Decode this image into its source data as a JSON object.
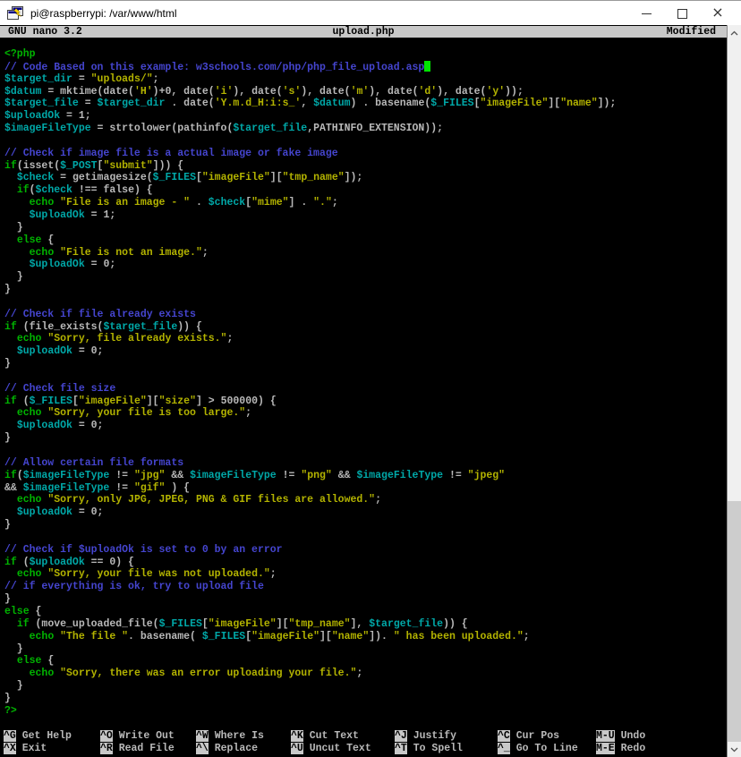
{
  "window": {
    "title": "pi@raspberrypi: /var/www/html",
    "controls": {
      "minimize": "minimize",
      "maximize": "maximize",
      "close": "close"
    }
  },
  "nano": {
    "app": "GNU nano 3.2",
    "filename": "upload.php",
    "status": "Modified"
  },
  "palette": {
    "background": "#000000",
    "default_text": "#b9b9b9",
    "keyword_green": "#00b300",
    "comment_blue": "#4545cf",
    "variable_teal": "#00a8a8",
    "string_yellow": "#b3b300",
    "cursor_green": "#00e400",
    "reverse_video": "#c8c8c8"
  },
  "editor": {
    "lines": [
      {
        "segs": [
          [
            "g",
            "<?php"
          ]
        ]
      },
      {
        "segs": [
          [
            "b",
            "// Code Based on this example: w3schools.com/php/php_file_upload.asp"
          ]
        ],
        "cursor": true
      },
      {
        "segs": [
          [
            "c",
            "$target_dir"
          ],
          [
            "w",
            " = "
          ],
          [
            "y",
            "\"uploads/\""
          ],
          [
            "w",
            ";"
          ]
        ]
      },
      {
        "segs": [
          [
            "c",
            "$datum"
          ],
          [
            "w",
            " = mktime(date("
          ],
          [
            "y",
            "'H'"
          ],
          [
            "w",
            ")+0, date("
          ],
          [
            "y",
            "'i'"
          ],
          [
            "w",
            "), date("
          ],
          [
            "y",
            "'s'"
          ],
          [
            "w",
            "), date("
          ],
          [
            "y",
            "'m'"
          ],
          [
            "w",
            "), date("
          ],
          [
            "y",
            "'d'"
          ],
          [
            "w",
            "), date("
          ],
          [
            "y",
            "'y'"
          ],
          [
            "w",
            "));"
          ]
        ]
      },
      {
        "segs": [
          [
            "c",
            "$target_file"
          ],
          [
            "w",
            " = "
          ],
          [
            "c",
            "$target_dir"
          ],
          [
            "w",
            " . date("
          ],
          [
            "y",
            "'Y.m.d_H:i:s_'"
          ],
          [
            "w",
            ", "
          ],
          [
            "c",
            "$datum"
          ],
          [
            "w",
            ") . basename("
          ],
          [
            "c",
            "$_FILES"
          ],
          [
            "w",
            "["
          ],
          [
            "y",
            "\"imageFile\""
          ],
          [
            "w",
            "]["
          ],
          [
            "y",
            "\"name\""
          ],
          [
            "w",
            "]);"
          ]
        ]
      },
      {
        "segs": [
          [
            "c",
            "$uploadOk"
          ],
          [
            "w",
            " = 1;"
          ]
        ]
      },
      {
        "segs": [
          [
            "c",
            "$imageFileType"
          ],
          [
            "w",
            " = strtolower(pathinfo("
          ],
          [
            "c",
            "$target_file"
          ],
          [
            "w",
            ",PATHINFO_EXTENSION));"
          ]
        ]
      },
      {
        "segs": []
      },
      {
        "segs": [
          [
            "b",
            "// Check if image file is a actual image or fake image"
          ]
        ]
      },
      {
        "segs": [
          [
            "g",
            "if"
          ],
          [
            "w",
            "(isset("
          ],
          [
            "c",
            "$_POST"
          ],
          [
            "w",
            "["
          ],
          [
            "y",
            "\"submit\""
          ],
          [
            "w",
            "])) {"
          ]
        ]
      },
      {
        "segs": [
          [
            "w",
            "  "
          ],
          [
            "c",
            "$check"
          ],
          [
            "w",
            " = getimagesize("
          ],
          [
            "c",
            "$_FILES"
          ],
          [
            "w",
            "["
          ],
          [
            "y",
            "\"imageFile\""
          ],
          [
            "w",
            "]["
          ],
          [
            "y",
            "\"tmp_name\""
          ],
          [
            "w",
            "]);"
          ]
        ]
      },
      {
        "segs": [
          [
            "w",
            "  "
          ],
          [
            "g",
            "if"
          ],
          [
            "w",
            "("
          ],
          [
            "c",
            "$check"
          ],
          [
            "w",
            " !== false) {"
          ]
        ]
      },
      {
        "segs": [
          [
            "w",
            "    "
          ],
          [
            "g",
            "echo"
          ],
          [
            "w",
            " "
          ],
          [
            "y",
            "\"File is an image - \""
          ],
          [
            "w",
            " . "
          ],
          [
            "c",
            "$check"
          ],
          [
            "w",
            "["
          ],
          [
            "y",
            "\"mime\""
          ],
          [
            "w",
            "] . "
          ],
          [
            "y",
            "\".\""
          ],
          [
            "w",
            ";"
          ]
        ]
      },
      {
        "segs": [
          [
            "w",
            "    "
          ],
          [
            "c",
            "$uploadOk"
          ],
          [
            "w",
            " = 1;"
          ]
        ]
      },
      {
        "segs": [
          [
            "w",
            "  }"
          ]
        ]
      },
      {
        "segs": [
          [
            "w",
            "  "
          ],
          [
            "g",
            "else"
          ],
          [
            "w",
            " {"
          ]
        ]
      },
      {
        "segs": [
          [
            "w",
            "    "
          ],
          [
            "g",
            "echo"
          ],
          [
            "w",
            " "
          ],
          [
            "y",
            "\"File is not an image.\""
          ],
          [
            "w",
            ";"
          ]
        ]
      },
      {
        "segs": [
          [
            "w",
            "    "
          ],
          [
            "c",
            "$uploadOk"
          ],
          [
            "w",
            " = 0;"
          ]
        ]
      },
      {
        "segs": [
          [
            "w",
            "  }"
          ]
        ]
      },
      {
        "segs": [
          [
            "w",
            "}"
          ]
        ]
      },
      {
        "segs": []
      },
      {
        "segs": [
          [
            "b",
            "// Check if file already exists"
          ]
        ]
      },
      {
        "segs": [
          [
            "g",
            "if"
          ],
          [
            "w",
            " (file_exists("
          ],
          [
            "c",
            "$target_file"
          ],
          [
            "w",
            ")) {"
          ]
        ]
      },
      {
        "segs": [
          [
            "w",
            "  "
          ],
          [
            "g",
            "echo"
          ],
          [
            "w",
            " "
          ],
          [
            "y",
            "\"Sorry, file already exists.\""
          ],
          [
            "w",
            ";"
          ]
        ]
      },
      {
        "segs": [
          [
            "w",
            "  "
          ],
          [
            "c",
            "$uploadOk"
          ],
          [
            "w",
            " = 0;"
          ]
        ]
      },
      {
        "segs": [
          [
            "w",
            "}"
          ]
        ]
      },
      {
        "segs": []
      },
      {
        "segs": [
          [
            "b",
            "// Check file size"
          ]
        ]
      },
      {
        "segs": [
          [
            "g",
            "if"
          ],
          [
            "w",
            " ("
          ],
          [
            "c",
            "$_FILES"
          ],
          [
            "w",
            "["
          ],
          [
            "y",
            "\"imageFile\""
          ],
          [
            "w",
            "]["
          ],
          [
            "y",
            "\"size\""
          ],
          [
            "w",
            "] > 500000) {"
          ]
        ]
      },
      {
        "segs": [
          [
            "w",
            "  "
          ],
          [
            "g",
            "echo"
          ],
          [
            "w",
            " "
          ],
          [
            "y",
            "\"Sorry, your file is too large.\""
          ],
          [
            "w",
            ";"
          ]
        ]
      },
      {
        "segs": [
          [
            "w",
            "  "
          ],
          [
            "c",
            "$uploadOk"
          ],
          [
            "w",
            " = 0;"
          ]
        ]
      },
      {
        "segs": [
          [
            "w",
            "}"
          ]
        ]
      },
      {
        "segs": []
      },
      {
        "segs": [
          [
            "b",
            "// Allow certain file formats"
          ]
        ]
      },
      {
        "segs": [
          [
            "g",
            "if"
          ],
          [
            "w",
            "("
          ],
          [
            "c",
            "$imageFileType"
          ],
          [
            "w",
            " != "
          ],
          [
            "y",
            "\"jpg\""
          ],
          [
            "w",
            " && "
          ],
          [
            "c",
            "$imageFileType"
          ],
          [
            "w",
            " != "
          ],
          [
            "y",
            "\"png\""
          ],
          [
            "w",
            " && "
          ],
          [
            "c",
            "$imageFileType"
          ],
          [
            "w",
            " != "
          ],
          [
            "y",
            "\"jpeg\""
          ]
        ]
      },
      {
        "segs": [
          [
            "w",
            "&& "
          ],
          [
            "c",
            "$imageFileType"
          ],
          [
            "w",
            " != "
          ],
          [
            "y",
            "\"gif\""
          ],
          [
            "w",
            " ) {"
          ]
        ]
      },
      {
        "segs": [
          [
            "w",
            "  "
          ],
          [
            "g",
            "echo"
          ],
          [
            "w",
            " "
          ],
          [
            "y",
            "\"Sorry, only JPG, JPEG, PNG & GIF files are allowed.\""
          ],
          [
            "w",
            ";"
          ]
        ]
      },
      {
        "segs": [
          [
            "w",
            "  "
          ],
          [
            "c",
            "$uploadOk"
          ],
          [
            "w",
            " = 0;"
          ]
        ]
      },
      {
        "segs": [
          [
            "w",
            "}"
          ]
        ]
      },
      {
        "segs": []
      },
      {
        "segs": [
          [
            "b",
            "// Check if $uploadOk is set to 0 by an error"
          ]
        ]
      },
      {
        "segs": [
          [
            "g",
            "if"
          ],
          [
            "w",
            " ("
          ],
          [
            "c",
            "$uploadOk"
          ],
          [
            "w",
            " == 0) {"
          ]
        ]
      },
      {
        "segs": [
          [
            "w",
            "  "
          ],
          [
            "g",
            "echo"
          ],
          [
            "w",
            " "
          ],
          [
            "y",
            "\"Sorry, your file was not uploaded.\""
          ],
          [
            "w",
            ";"
          ]
        ]
      },
      {
        "segs": [
          [
            "b",
            "// if everything is ok, try to upload file"
          ]
        ]
      },
      {
        "segs": [
          [
            "w",
            "}"
          ]
        ]
      },
      {
        "segs": [
          [
            "g",
            "else"
          ],
          [
            "w",
            " {"
          ]
        ]
      },
      {
        "segs": [
          [
            "w",
            "  "
          ],
          [
            "g",
            "if"
          ],
          [
            "w",
            " (move_uploaded_file("
          ],
          [
            "c",
            "$_FILES"
          ],
          [
            "w",
            "["
          ],
          [
            "y",
            "\"imageFile\""
          ],
          [
            "w",
            "]["
          ],
          [
            "y",
            "\"tmp_name\""
          ],
          [
            "w",
            "], "
          ],
          [
            "c",
            "$target_file"
          ],
          [
            "w",
            ")) {"
          ]
        ]
      },
      {
        "segs": [
          [
            "w",
            "    "
          ],
          [
            "g",
            "echo"
          ],
          [
            "w",
            " "
          ],
          [
            "y",
            "\"The file \""
          ],
          [
            "w",
            ". basename( "
          ],
          [
            "c",
            "$_FILES"
          ],
          [
            "w",
            "["
          ],
          [
            "y",
            "\"imageFile\""
          ],
          [
            "w",
            "]["
          ],
          [
            "y",
            "\"name\""
          ],
          [
            "w",
            "]). "
          ],
          [
            "y",
            "\" has been uploaded.\""
          ],
          [
            "w",
            ";"
          ]
        ]
      },
      {
        "segs": [
          [
            "w",
            "  }"
          ]
        ]
      },
      {
        "segs": [
          [
            "w",
            "  "
          ],
          [
            "g",
            "else"
          ],
          [
            "w",
            " {"
          ]
        ]
      },
      {
        "segs": [
          [
            "w",
            "    "
          ],
          [
            "g",
            "echo"
          ],
          [
            "w",
            " "
          ],
          [
            "y",
            "\"Sorry, there was an error uploading your file.\""
          ],
          [
            "w",
            ";"
          ]
        ]
      },
      {
        "segs": [
          [
            "w",
            "  }"
          ]
        ]
      },
      {
        "segs": [
          [
            "w",
            "}"
          ]
        ]
      },
      {
        "segs": [
          [
            "g",
            "?>"
          ]
        ]
      }
    ]
  },
  "shortcuts": {
    "rows": [
      [
        {
          "key": "^G",
          "label": "Get Help"
        },
        {
          "key": "^O",
          "label": "Write Out"
        },
        {
          "key": "^W",
          "label": "Where Is"
        },
        {
          "key": "^K",
          "label": "Cut Text"
        },
        {
          "key": "^J",
          "label": "Justify"
        },
        {
          "key": "^C",
          "label": "Cur Pos"
        },
        {
          "key": "M-U",
          "label": "Undo"
        }
      ],
      [
        {
          "key": "^X",
          "label": "Exit"
        },
        {
          "key": "^R",
          "label": "Read File"
        },
        {
          "key": "^\\",
          "label": "Replace"
        },
        {
          "key": "^U",
          "label": "Uncut Text"
        },
        {
          "key": "^T",
          "label": "To Spell"
        },
        {
          "key": "^_",
          "label": "Go To Line"
        },
        {
          "key": "M-E",
          "label": "Redo"
        }
      ]
    ]
  }
}
